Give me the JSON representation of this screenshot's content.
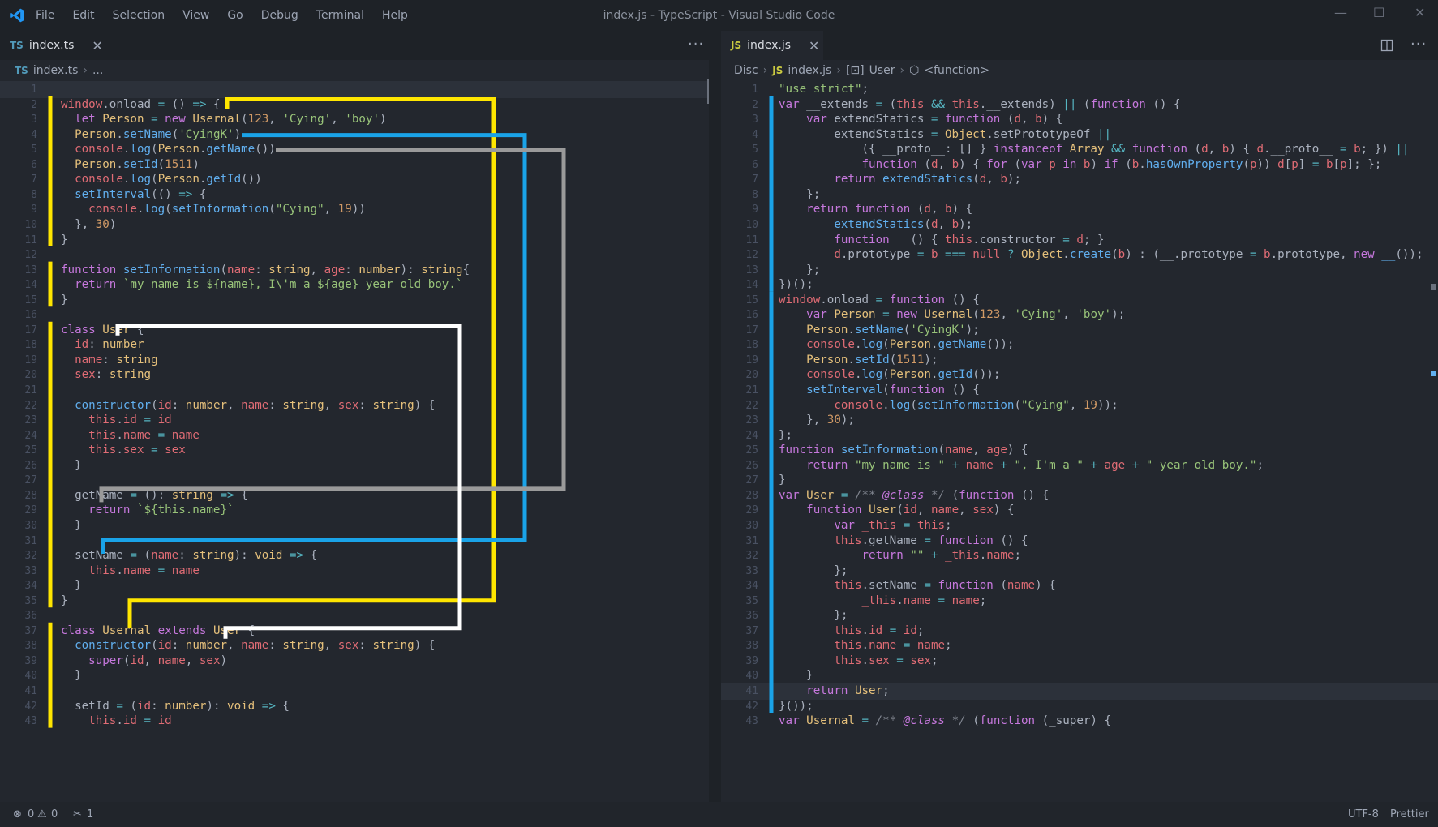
{
  "window": {
    "title": "index.js - TypeScript - Visual Studio Code",
    "menu": [
      "File",
      "Edit",
      "Selection",
      "View",
      "Go",
      "Debug",
      "Terminal",
      "Help"
    ],
    "controls": {
      "minimize": "—",
      "maximize": "☐",
      "close": "✕"
    }
  },
  "left_editor": {
    "tab": {
      "lang": "TS",
      "label": "index.ts",
      "close": "✕"
    },
    "more": "···",
    "breadcrumb": {
      "lang": "TS",
      "file": "index.ts",
      "rest": "..."
    },
    "lines": [
      {
        "n": "1",
        "src": ""
      },
      {
        "n": "2",
        "src": "window.onload = () => {"
      },
      {
        "n": "3",
        "src": "  let Person = new Usernal(123, 'Cying', 'boy')"
      },
      {
        "n": "4",
        "src": "  Person.setName('CyingK')"
      },
      {
        "n": "5",
        "src": "  console.log(Person.getName())"
      },
      {
        "n": "6",
        "src": "  Person.setId(1511)"
      },
      {
        "n": "7",
        "src": "  console.log(Person.getId())"
      },
      {
        "n": "8",
        "src": "  setInterval(() => {"
      },
      {
        "n": "9",
        "src": "    console.log(setInformation(\"Cying\", 19))"
      },
      {
        "n": "10",
        "src": "  }, 30)"
      },
      {
        "n": "11",
        "src": "}"
      },
      {
        "n": "12",
        "src": ""
      },
      {
        "n": "13",
        "src": "function setInformation(name: string, age: number): string{"
      },
      {
        "n": "14",
        "src": "  return `my name is ${name}, I\\'m a ${age} year old boy.`"
      },
      {
        "n": "15",
        "src": "}"
      },
      {
        "n": "16",
        "src": ""
      },
      {
        "n": "17",
        "src": "class User {"
      },
      {
        "n": "18",
        "src": "  id: number"
      },
      {
        "n": "19",
        "src": "  name: string"
      },
      {
        "n": "20",
        "src": "  sex: string"
      },
      {
        "n": "21",
        "src": ""
      },
      {
        "n": "22",
        "src": "  constructor(id: number, name: string, sex: string) {"
      },
      {
        "n": "23",
        "src": "    this.id = id"
      },
      {
        "n": "24",
        "src": "    this.name = name"
      },
      {
        "n": "25",
        "src": "    this.sex = sex"
      },
      {
        "n": "26",
        "src": "  }"
      },
      {
        "n": "27",
        "src": ""
      },
      {
        "n": "28",
        "src": "  getName = (): string => {"
      },
      {
        "n": "29",
        "src": "    return `${this.name}`"
      },
      {
        "n": "30",
        "src": "  }"
      },
      {
        "n": "31",
        "src": ""
      },
      {
        "n": "32",
        "src": "  setName = (name: string): void => {"
      },
      {
        "n": "33",
        "src": "    this.name = name"
      },
      {
        "n": "34",
        "src": "  }"
      },
      {
        "n": "35",
        "src": "}"
      },
      {
        "n": "36",
        "src": ""
      },
      {
        "n": "37",
        "src": "class Usernal extends User {"
      },
      {
        "n": "38",
        "src": "  constructor(id: number, name: string, sex: string) {"
      },
      {
        "n": "39",
        "src": "    super(id, name, sex)"
      },
      {
        "n": "40",
        "src": "  }"
      },
      {
        "n": "41",
        "src": ""
      },
      {
        "n": "42",
        "src": "  setId = (id: number): void => {"
      },
      {
        "n": "43",
        "src": "    this.id = id"
      }
    ]
  },
  "right_editor": {
    "tab": {
      "lang": "JS",
      "label": "index.js",
      "close": "✕"
    },
    "split_icon": "split-editor-icon",
    "more": "···",
    "breadcrumb": {
      "disc": "Disc",
      "lang": "JS",
      "file": "index.js",
      "sym1": "User",
      "sym2": "<function>"
    },
    "lines": [
      {
        "n": "1",
        "src": "\"use strict\";"
      },
      {
        "n": "2",
        "src": "var __extends = (this && this.__extends) || (function () {"
      },
      {
        "n": "3",
        "src": "    var extendStatics = function (d, b) {"
      },
      {
        "n": "4",
        "src": "        extendStatics = Object.setPrototypeOf ||"
      },
      {
        "n": "5",
        "src": "            ({ __proto__: [] } instanceof Array && function (d, b) { d.__proto__ = b; }) ||"
      },
      {
        "n": "6",
        "src": "            function (d, b) { for (var p in b) if (b.hasOwnProperty(p)) d[p] = b[p]; };"
      },
      {
        "n": "7",
        "src": "        return extendStatics(d, b);"
      },
      {
        "n": "8",
        "src": "    };"
      },
      {
        "n": "9",
        "src": "    return function (d, b) {"
      },
      {
        "n": "10",
        "src": "        extendStatics(d, b);"
      },
      {
        "n": "11",
        "src": "        function __() { this.constructor = d; }"
      },
      {
        "n": "12",
        "src": "        d.prototype = b === null ? Object.create(b) : (__.prototype = b.prototype, new __());"
      },
      {
        "n": "13",
        "src": "    };"
      },
      {
        "n": "14",
        "src": "})();"
      },
      {
        "n": "15",
        "src": "window.onload = function () {"
      },
      {
        "n": "16",
        "src": "    var Person = new Usernal(123, 'Cying', 'boy');"
      },
      {
        "n": "17",
        "src": "    Person.setName('CyingK');"
      },
      {
        "n": "18",
        "src": "    console.log(Person.getName());"
      },
      {
        "n": "19",
        "src": "    Person.setId(1511);"
      },
      {
        "n": "20",
        "src": "    console.log(Person.getId());"
      },
      {
        "n": "21",
        "src": "    setInterval(function () {"
      },
      {
        "n": "22",
        "src": "        console.log(setInformation(\"Cying\", 19));"
      },
      {
        "n": "23",
        "src": "    }, 30);"
      },
      {
        "n": "24",
        "src": "};"
      },
      {
        "n": "25",
        "src": "function setInformation(name, age) {"
      },
      {
        "n": "26",
        "src": "    return \"my name is \" + name + \", I'm a \" + age + \" year old boy.\";"
      },
      {
        "n": "27",
        "src": "}"
      },
      {
        "n": "28",
        "src": "var User = /** @class */ (function () {"
      },
      {
        "n": "29",
        "src": "    function User(id, name, sex) {"
      },
      {
        "n": "30",
        "src": "        var _this = this;"
      },
      {
        "n": "31",
        "src": "        this.getName = function () {"
      },
      {
        "n": "32",
        "src": "            return \"\" + _this.name;"
      },
      {
        "n": "33",
        "src": "        };"
      },
      {
        "n": "34",
        "src": "        this.setName = function (name) {"
      },
      {
        "n": "35",
        "src": "            _this.name = name;"
      },
      {
        "n": "36",
        "src": "        };"
      },
      {
        "n": "37",
        "src": "        this.id = id;"
      },
      {
        "n": "38",
        "src": "        this.name = name;"
      },
      {
        "n": "39",
        "src": "        this.sex = sex;"
      },
      {
        "n": "40",
        "src": "    }"
      },
      {
        "n": "41",
        "src": "    return User;"
      },
      {
        "n": "42",
        "src": "}());"
      },
      {
        "n": "43",
        "src": "var Usernal = /** @class */ (function (_super) {"
      }
    ]
  },
  "status": {
    "errors": "0",
    "warnings": "0",
    "tools": "1",
    "encoding": "UTF-8",
    "formatter": "Prettier"
  },
  "colors": {
    "background": "#23272e",
    "titlebar": "#1e2227",
    "yellow_guide": "#ffe600",
    "blue_guide": "#1aa3e8",
    "white_guide": "#ffffff",
    "gray_guide": "#9a9a9a"
  }
}
